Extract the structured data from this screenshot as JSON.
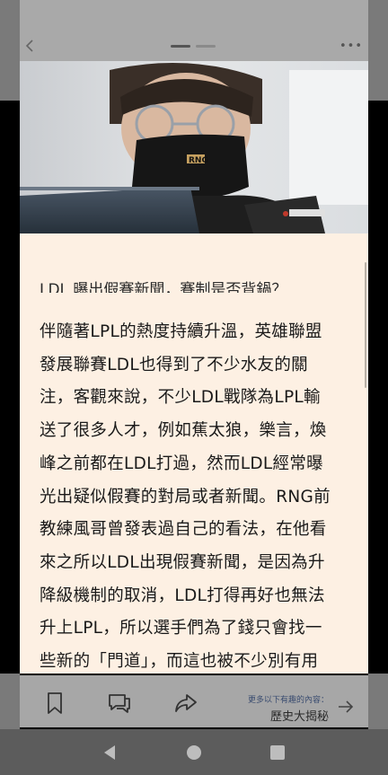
{
  "header": {
    "back_icon": "chevron-left-icon",
    "more_icon": "ellipsis-icon",
    "more_label": "•••"
  },
  "photo": {
    "description_icon": "article-photo",
    "mask_logo": "RNG"
  },
  "article": {
    "title": "LDL 曝出假賽新聞，賽制是否背鍋？",
    "body_lines": [
      "伴隨著LPL的熱度持續升溫，英雄聯盟",
      "發展聯賽LDL也得到了不少水友的關",
      "注，客觀來說，不少LDL戰隊為LPL輸",
      "送了很多人才，例如蕉太狼，樂言，煥",
      "峰之前都在LDL打過，然而LDL經常曝",
      "光出疑似假賽的對局或者新聞。RNG前",
      "教練風哥曾發表過自己的看法，在他看",
      "來之所以LDL出現假賽新聞，是因為升",
      "降級機制的取消，LDL打得再好也無法",
      "升上LPL，所以選手們為了錢只會找一",
      "些新的「門道」，而這也被不少別有用"
    ]
  },
  "bottom_bar": {
    "bookmark_icon": "bookmark-icon",
    "comment_icon": "comment-icon",
    "share_icon": "share-icon",
    "next_label": "更多以下有趣的內容：",
    "next_title": "歷史大揭秘",
    "next_icon": "arrow-right-icon"
  },
  "nav": {
    "back_icon": "triangle-back-icon",
    "home_icon": "circle-home-icon",
    "recents_icon": "square-recents-icon"
  },
  "colors": {
    "article_bg": "#fdf0e3",
    "overlay_gray": "#a7a7a7",
    "nav_bg": "#5c5c5c"
  }
}
